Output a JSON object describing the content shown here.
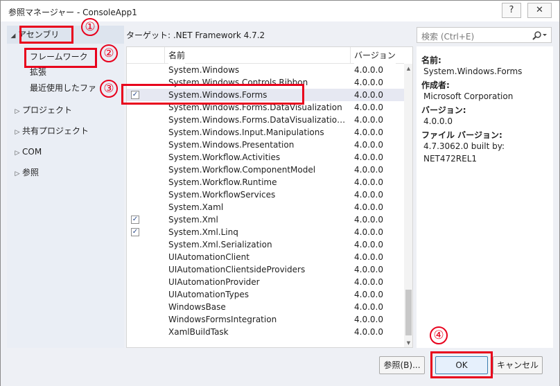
{
  "window": {
    "title": "参照マネージャー - ConsoleApp1",
    "help_label": "?",
    "close_label": "✕"
  },
  "sidebar": {
    "assemblies_label": "アセンブリ",
    "framework_label": "フレームワーク",
    "extensions_label": "拡張",
    "recent_label": "最近使用したファ",
    "projects_label": "プロジェクト",
    "shared_projects_label": "共有プロジェクト",
    "com_label": "COM",
    "browse_label": "参照"
  },
  "target": "ターゲット: .NET Framework 4.7.2",
  "search": {
    "placeholder": "検索 (Ctrl+E)"
  },
  "table": {
    "headers": {
      "name": "名前",
      "version": "バージョン"
    },
    "rows": [
      {
        "name": "System.Windows",
        "version": "4.0.0.0",
        "checked": false
      },
      {
        "name": "System.Windows.Controls.Ribbon",
        "version": "4.0.0.0",
        "checked": false
      },
      {
        "name": "System.Windows.Forms",
        "version": "4.0.0.0",
        "checked": true
      },
      {
        "name": "System.Windows.Forms.DataVisualization",
        "version": "4.0.0.0",
        "checked": false
      },
      {
        "name": "System.Windows.Forms.DataVisualizatio…",
        "version": "4.0.0.0",
        "checked": false
      },
      {
        "name": "System.Windows.Input.Manipulations",
        "version": "4.0.0.0",
        "checked": false
      },
      {
        "name": "System.Windows.Presentation",
        "version": "4.0.0.0",
        "checked": false
      },
      {
        "name": "System.Workflow.Activities",
        "version": "4.0.0.0",
        "checked": false
      },
      {
        "name": "System.Workflow.ComponentModel",
        "version": "4.0.0.0",
        "checked": false
      },
      {
        "name": "System.Workflow.Runtime",
        "version": "4.0.0.0",
        "checked": false
      },
      {
        "name": "System.WorkflowServices",
        "version": "4.0.0.0",
        "checked": false
      },
      {
        "name": "System.Xaml",
        "version": "4.0.0.0",
        "checked": false
      },
      {
        "name": "System.Xml",
        "version": "4.0.0.0",
        "checked": true
      },
      {
        "name": "System.Xml.Linq",
        "version": "4.0.0.0",
        "checked": true
      },
      {
        "name": "System.Xml.Serialization",
        "version": "4.0.0.0",
        "checked": false
      },
      {
        "name": "UIAutomationClient",
        "version": "4.0.0.0",
        "checked": false
      },
      {
        "name": "UIAutomationClientsideProviders",
        "version": "4.0.0.0",
        "checked": false
      },
      {
        "name": "UIAutomationProvider",
        "version": "4.0.0.0",
        "checked": false
      },
      {
        "name": "UIAutomationTypes",
        "version": "4.0.0.0",
        "checked": false
      },
      {
        "name": "WindowsBase",
        "version": "4.0.0.0",
        "checked": false
      },
      {
        "name": "WindowsFormsIntegration",
        "version": "4.0.0.0",
        "checked": false
      },
      {
        "name": "XamlBuildTask",
        "version": "4.0.0.0",
        "checked": false
      }
    ]
  },
  "details": {
    "name_label": "名前:",
    "name_value": "System.Windows.Forms",
    "author_label": "作成者:",
    "author_value": "Microsoft Corporation",
    "version_label": "バージョン:",
    "version_value": "4.0.0.0",
    "file_version_label": "ファイル バージョン:",
    "file_version_value_1": "4.7.3062.0 built by:",
    "file_version_value_2": "NET472REL1"
  },
  "buttons": {
    "browse": "参照(B)...",
    "ok": "OK",
    "cancel": "キャンセル"
  },
  "annotations": {
    "one": "①",
    "two": "②",
    "three": "③",
    "four": "④"
  },
  "colors": {
    "highlight": "#e8001c",
    "selected_row": "#e6e8f2",
    "ok_button": "#e6f0fc"
  }
}
